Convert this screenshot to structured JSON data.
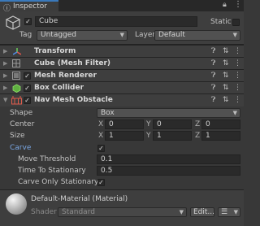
{
  "window": {
    "tab_label": "Inspector"
  },
  "header": {
    "object_name": "Cube",
    "static_label": "Static",
    "tag_label": "Tag",
    "tag_value": "Untagged",
    "layer_label": "Layer",
    "layer_value": "Default"
  },
  "components": {
    "transform": "Transform",
    "mesh_filter": "Cube (Mesh Filter)",
    "mesh_renderer": "Mesh Renderer",
    "box_collider": "Box Collider",
    "nav_mesh_obstacle": "Nav Mesh Obstacle"
  },
  "obstacle": {
    "shape_label": "Shape",
    "shape_value": "Box",
    "center_label": "Center",
    "center": {
      "x": "0",
      "y": "0",
      "z": "0"
    },
    "size_label": "Size",
    "size": {
      "x": "1",
      "y": "1",
      "z": "1"
    },
    "axis": {
      "x": "X",
      "y": "Y",
      "z": "Z"
    },
    "carve_label": "Carve",
    "move_threshold_label": "Move Threshold",
    "move_threshold_value": "0.1",
    "time_to_stationary_label": "Time To Stationary",
    "time_to_stationary_value": "0.5",
    "carve_only_stationary_label": "Carve Only Stationary"
  },
  "material": {
    "name": "Default-Material (Material)",
    "shader_label": "Shader",
    "shader_value": "Standard",
    "edit_label": "Edit..."
  },
  "icons": [
    "info-icon",
    "lock-icon",
    "menu-icon",
    "help-icon",
    "preset-icon",
    "more-icon"
  ]
}
